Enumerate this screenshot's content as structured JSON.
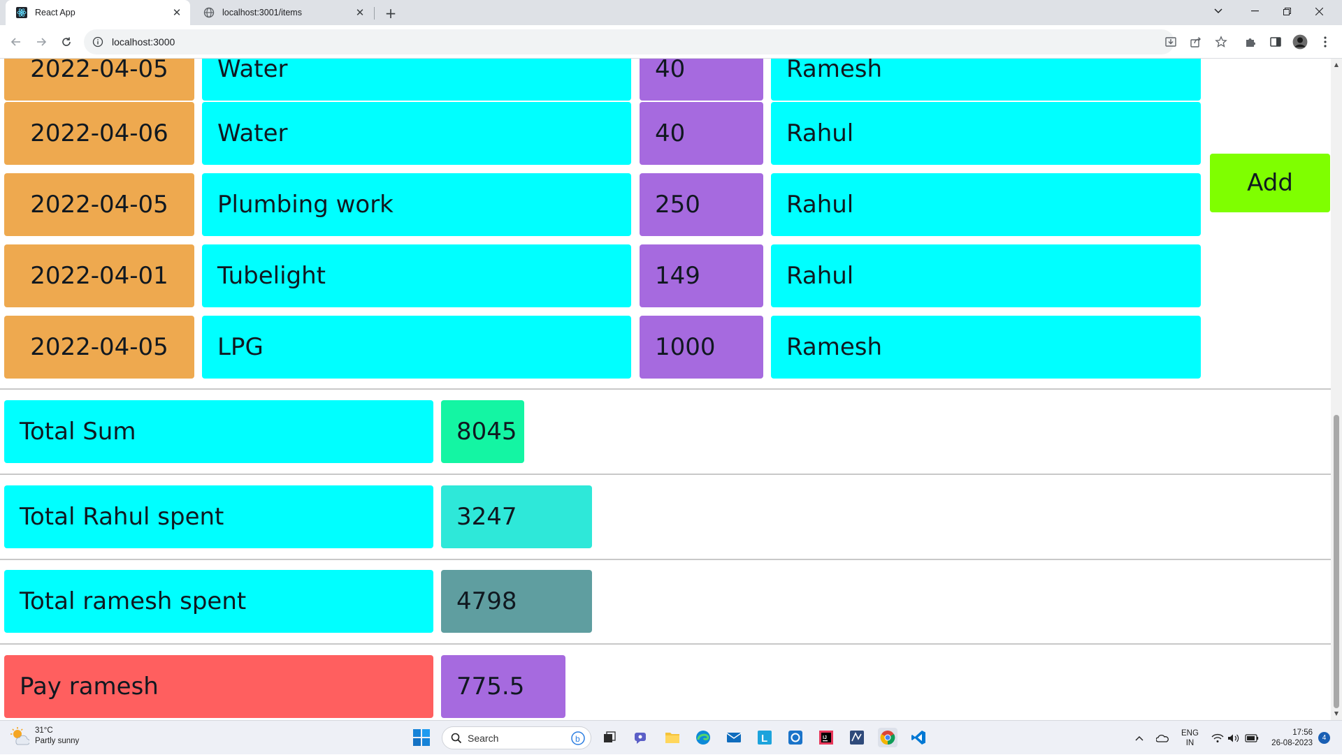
{
  "browser": {
    "tabs": [
      {
        "title": "React App",
        "active": true
      },
      {
        "title": "localhost:3001/items",
        "active": false
      }
    ],
    "url": "localhost:3000"
  },
  "expenses": [
    {
      "date": "2022-04-05",
      "item": "Water",
      "amount": "40",
      "person": "Ramesh"
    },
    {
      "date": "2022-04-06",
      "item": "Water",
      "amount": "40",
      "person": "Rahul"
    },
    {
      "date": "2022-04-05",
      "item": "Plumbing work",
      "amount": "250",
      "person": "Rahul"
    },
    {
      "date": "2022-04-01",
      "item": "Tubelight",
      "amount": "149",
      "person": "Rahul"
    },
    {
      "date": "2022-04-05",
      "item": "LPG",
      "amount": "1000",
      "person": "Ramesh"
    }
  ],
  "add_button_label": "Add",
  "summary": {
    "total_sum": {
      "label": "Total Sum",
      "value": "8045"
    },
    "rahul": {
      "label": "Total Rahul spent",
      "value": "3247"
    },
    "ramesh": {
      "label": "Total ramesh spent",
      "value": "4798"
    },
    "pay": {
      "label": "Pay ramesh",
      "value": "775.5"
    }
  },
  "colors": {
    "date_cell": "#eea94f",
    "text_cell": "#00ffff",
    "amount_cell": "#a66adf",
    "add_button": "#7fff00",
    "total_sum_value": "#14f5a3",
    "rahul_value": "#2ee8d9",
    "ramesh_value": "#5f9ea0",
    "pay_label": "#ff5f5f",
    "pay_value": "#a66adf"
  },
  "taskbar": {
    "weather_temp": "31°C",
    "weather_desc": "Partly sunny",
    "search_placeholder": "Search",
    "lang_top": "ENG",
    "lang_bottom": "IN",
    "time": "17:56",
    "date": "26-08-2023",
    "notification_count": "4"
  }
}
